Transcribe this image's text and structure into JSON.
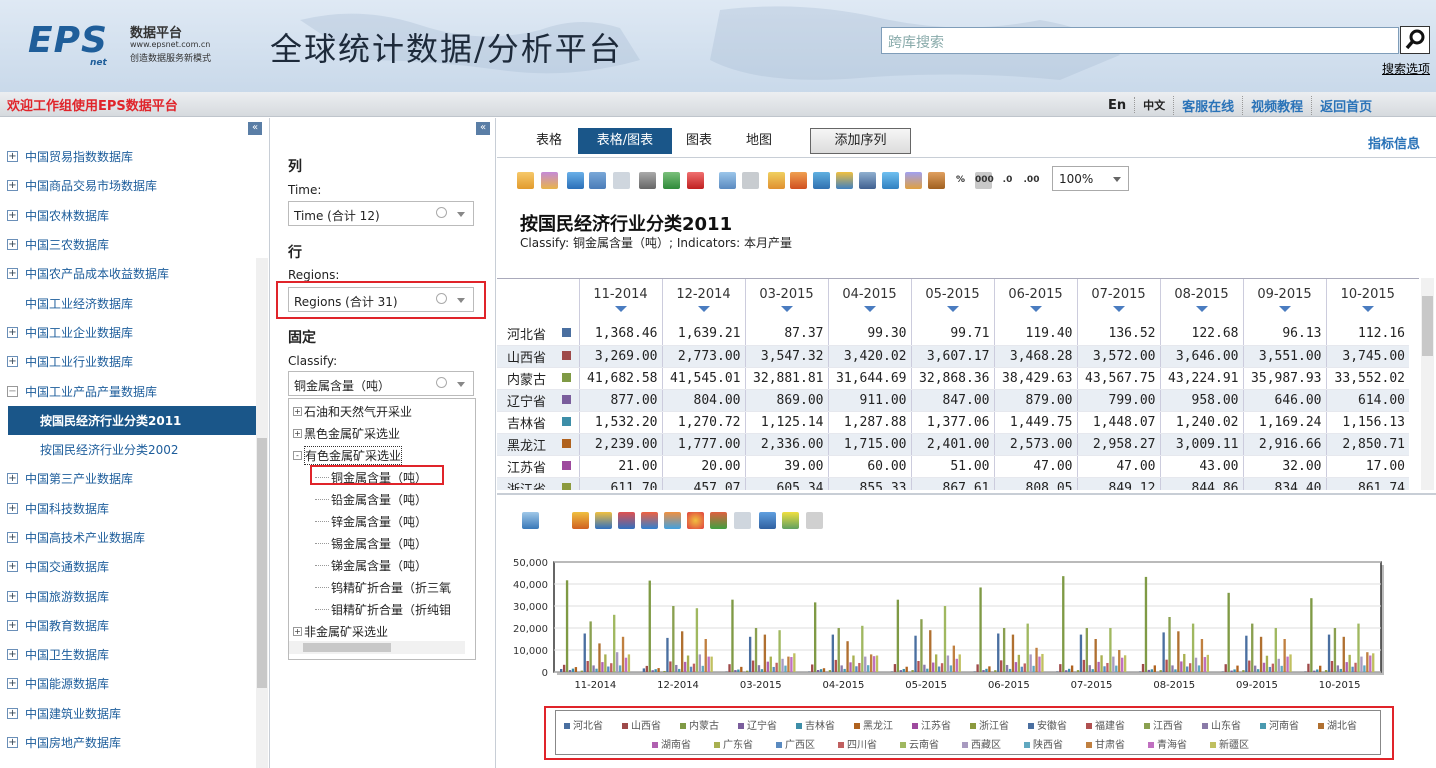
{
  "header": {
    "logo": {
      "brand": "EPS",
      "net": "net",
      "cn": "数据平台",
      "url": "www.epsnet.com.cn",
      "slogan": "创造数据服务新模式"
    },
    "title": "全球统计数据/分析平台",
    "search_placeholder": "跨库搜索",
    "search_options": "搜索选项"
  },
  "topbar": {
    "welcome": "欢迎工作组使用EPS数据平台",
    "links": [
      "En",
      "中文",
      "客服在线",
      "视频教程",
      "返回首页"
    ]
  },
  "sidebar": {
    "collapse": "«",
    "items": [
      {
        "label": "中国贸易指数数据库",
        "type": "db"
      },
      {
        "label": "中国商品交易市场数据库",
        "type": "db"
      },
      {
        "label": "中国农林数据库",
        "type": "db"
      },
      {
        "label": "中国三农数据库",
        "type": "db"
      },
      {
        "label": "中国农产品成本收益数据库",
        "type": "db"
      },
      {
        "label": "中国工业经济数据库",
        "type": "sub2"
      },
      {
        "label": "中国工业企业数据库",
        "type": "db"
      },
      {
        "label": "中国工业行业数据库",
        "type": "db"
      },
      {
        "label": "中国工业产品产量数据库",
        "type": "open"
      },
      {
        "label": "按国民经济行业分类2011",
        "type": "selected"
      },
      {
        "label": "按国民经济行业分类2002",
        "type": "sub"
      },
      {
        "label": "中国第三产业数据库",
        "type": "db"
      },
      {
        "label": "中国科技数据库",
        "type": "db"
      },
      {
        "label": "中国高技术产业数据库",
        "type": "db"
      },
      {
        "label": "中国交通数据库",
        "type": "db"
      },
      {
        "label": "中国旅游数据库",
        "type": "db"
      },
      {
        "label": "中国教育数据库",
        "type": "db"
      },
      {
        "label": "中国卫生数据库",
        "type": "db"
      },
      {
        "label": "中国能源数据库",
        "type": "db"
      },
      {
        "label": "中国建筑业数据库",
        "type": "db"
      },
      {
        "label": "中国房地产数据库",
        "type": "db"
      }
    ]
  },
  "dims": {
    "col_heading": "列",
    "time_label": "Time:",
    "time_value": "Time (合计 12)",
    "row_heading": "行",
    "regions_label": "Regions:",
    "regions_value": "Regions (合计 31)",
    "fixed_heading": "固定",
    "classify_label": "Classify:",
    "classify_value": "铜金属含量（吨）",
    "tree": [
      {
        "label": "石油和天然气开采业",
        "box": "+",
        "level": 0
      },
      {
        "label": "黑色金属矿采选业",
        "box": "+",
        "level": 0
      },
      {
        "label": "有色金属矿采选业",
        "box": "-",
        "level": 0
      },
      {
        "label": "铜金属含量（吨）",
        "box": "",
        "level": 1
      },
      {
        "label": "铅金属含量（吨）",
        "box": "",
        "level": 1
      },
      {
        "label": "锌金属含量（吨）",
        "box": "",
        "level": 1
      },
      {
        "label": "锡金属含量（吨）",
        "box": "",
        "level": 1
      },
      {
        "label": "锑金属含量（吨）",
        "box": "",
        "level": 1
      },
      {
        "label": "钨精矿折合量（折三氧",
        "box": "",
        "level": 1
      },
      {
        "label": "钼精矿折合量（折纯钼",
        "box": "",
        "level": 1
      },
      {
        "label": "非金属矿采选业",
        "box": "+",
        "level": 0
      }
    ]
  },
  "main": {
    "tabs": [
      "表格",
      "表格/图表",
      "图表",
      "地图"
    ],
    "active_tab": 1,
    "add_series": "添加序列",
    "indicator_info": "指标信息",
    "zoom": "100%",
    "percent_icon": "%",
    "thousands_icon": "000",
    "dec_icons": [
      ".0",
      ".00"
    ],
    "table_title": "按国民经济行业分类2011",
    "table_subtitle": "Classify: 铜金属含量（吨）; Indicators: 本月产量"
  },
  "table": {
    "columns": [
      "11-2014",
      "12-2014",
      "03-2015",
      "04-2015",
      "05-2015",
      "06-2015",
      "07-2015",
      "08-2015",
      "09-2015",
      "10-2015"
    ],
    "rows": [
      {
        "name": "河北省",
        "color": "#4a6fa0",
        "values": [
          "1,368.46",
          "1,639.21",
          "87.37",
          "99.30",
          "99.71",
          "119.40",
          "136.52",
          "122.68",
          "96.13",
          "112.16"
        ]
      },
      {
        "name": "山西省",
        "color": "#9e4a4a",
        "values": [
          "3,269.00",
          "2,773.00",
          "3,547.32",
          "3,420.02",
          "3,607.17",
          "3,468.28",
          "3,572.00",
          "3,646.00",
          "3,551.00",
          "3,745.00"
        ]
      },
      {
        "name": "内蒙古",
        "color": "#7f9a45",
        "values": [
          "41,682.58",
          "41,545.01",
          "32,881.81",
          "31,644.69",
          "32,868.36",
          "38,429.63",
          "43,567.75",
          "43,224.91",
          "35,987.93",
          "33,552.02"
        ]
      },
      {
        "name": "辽宁省",
        "color": "#7a5d9c",
        "values": [
          "877.00",
          "804.00",
          "869.00",
          "911.00",
          "847.00",
          "879.00",
          "799.00",
          "958.00",
          "646.00",
          "614.00"
        ]
      },
      {
        "name": "吉林省",
        "color": "#3d8ea8",
        "values": [
          "1,532.20",
          "1,270.72",
          "1,125.14",
          "1,287.88",
          "1,377.06",
          "1,449.75",
          "1,448.07",
          "1,240.02",
          "1,169.24",
          "1,156.13"
        ]
      },
      {
        "name": "黑龙江",
        "color": "#b0621e",
        "values": [
          "2,239.00",
          "1,777.00",
          "2,336.00",
          "1,715.00",
          "2,401.00",
          "2,573.00",
          "2,958.27",
          "3,009.11",
          "2,916.66",
          "2,850.71"
        ]
      },
      {
        "name": "江苏省",
        "color": "#9e4a9e",
        "values": [
          "21.00",
          "20.00",
          "39.00",
          "60.00",
          "51.00",
          "47.00",
          "47.00",
          "43.00",
          "32.00",
          "17.00"
        ]
      },
      {
        "name": "浙江省",
        "color": "#8c9a3e",
        "values": [
          "611.70",
          "457.07",
          "605.34",
          "855.33",
          "867.61",
          "808.05",
          "849.12",
          "844.86",
          "834.40",
          "861.74"
        ]
      }
    ]
  },
  "chart_data": {
    "type": "bar",
    "categories": [
      "11-2014",
      "12-2014",
      "03-2015",
      "04-2015",
      "05-2015",
      "06-2015",
      "07-2015",
      "08-2015",
      "09-2015",
      "10-2015"
    ],
    "ylim": [
      0,
      50000
    ],
    "yticks": [
      "0",
      "10,000",
      "20,000",
      "30,000",
      "40,000",
      "50,000"
    ],
    "grid": true,
    "legend_position": "bottom",
    "series": [
      {
        "name": "河北省",
        "color": "#4a6fa0",
        "values": [
          1368.46,
          1639.21,
          87.37,
          99.3,
          99.71,
          119.4,
          136.52,
          122.68,
          96.13,
          112.16
        ]
      },
      {
        "name": "山西省",
        "color": "#9e4a4a",
        "values": [
          3269,
          2773,
          3547.32,
          3420.02,
          3607.17,
          3468.28,
          3572,
          3646,
          3551,
          3745
        ]
      },
      {
        "name": "内蒙古",
        "color": "#7f9a45",
        "values": [
          41682.58,
          41545.01,
          32881.81,
          31644.69,
          32868.36,
          38429.63,
          43567.75,
          43224.91,
          35987.93,
          33552.02
        ]
      },
      {
        "name": "辽宁省",
        "color": "#7a5d9c",
        "values": [
          877,
          804,
          869,
          911,
          847,
          879,
          799,
          958,
          646,
          614
        ]
      },
      {
        "name": "吉林省",
        "color": "#3d8ea8",
        "values": [
          1532.2,
          1270.72,
          1125.14,
          1287.88,
          1377.06,
          1449.75,
          1448.07,
          1240.02,
          1169.24,
          1156.13
        ]
      },
      {
        "name": "黑龙江",
        "color": "#b0621e",
        "values": [
          2239,
          1777,
          2336,
          1715,
          2401,
          2573,
          2958.27,
          3009.11,
          2916.66,
          2850.71
        ]
      },
      {
        "name": "江苏省",
        "color": "#9e4a9e",
        "values": [
          21,
          20,
          39,
          60,
          51,
          47,
          47,
          43,
          32,
          17
        ]
      },
      {
        "name": "浙江省",
        "color": "#8c9a3e",
        "values": [
          611.7,
          457.07,
          605.34,
          855.33,
          867.61,
          808.05,
          849.12,
          844.86,
          834.4,
          861.74
        ]
      },
      {
        "name": "安徽省",
        "color": "#4a6fa0",
        "values": [
          17500,
          15500,
          16000,
          17000,
          16500,
          17500,
          17000,
          18000,
          16500,
          17000
        ]
      },
      {
        "name": "福建省",
        "color": "#b05050",
        "values": [
          5000,
          4800,
          5200,
          5500,
          5000,
          5300,
          5500,
          5600,
          5200,
          5000
        ]
      },
      {
        "name": "江西省",
        "color": "#8aa050",
        "values": [
          23000,
          30000,
          20000,
          20000,
          24000,
          20000,
          20000,
          25000,
          22000,
          20000
        ]
      },
      {
        "name": "山东省",
        "color": "#8a7aa8",
        "values": [
          3000,
          3200,
          3100,
          3000,
          3300,
          3200,
          3100,
          3000,
          2900,
          3000
        ]
      },
      {
        "name": "河南省",
        "color": "#4a9ab0",
        "values": [
          1500,
          1400,
          1300,
          1400,
          1500,
          1400,
          1300,
          1200,
          1300,
          1400
        ]
      },
      {
        "name": "湖北省",
        "color": "#b07030",
        "values": [
          13000,
          18500,
          17000,
          14000,
          19000,
          17000,
          15000,
          18500,
          16000,
          16000
        ]
      },
      {
        "name": "湖南省",
        "color": "#b060b0",
        "values": [
          4500,
          4600,
          4700,
          4400,
          4300,
          4500,
          4600,
          4800,
          4200,
          4500
        ]
      },
      {
        "name": "广东省",
        "color": "#a8b050",
        "values": [
          8000,
          7500,
          7000,
          7500,
          8000,
          7800,
          7600,
          8200,
          7400,
          7800
        ]
      },
      {
        "name": "广西区",
        "color": "#5a8ac0",
        "values": [
          2500,
          2400,
          2300,
          2600,
          2500,
          2400,
          2600,
          2500,
          2300,
          2400
        ]
      },
      {
        "name": "四川省",
        "color": "#c06060",
        "values": [
          4000,
          3800,
          4200,
          4100,
          4000,
          3900,
          4100,
          4000,
          3800,
          4200
        ]
      },
      {
        "name": "云南省",
        "color": "#a0b860",
        "values": [
          26000,
          29000,
          19000,
          21000,
          30000,
          22000,
          20000,
          22000,
          20000,
          22000
        ]
      },
      {
        "name": "西藏区",
        "color": "#a89ac0",
        "values": [
          9000,
          8000,
          6000,
          7000,
          7500,
          8000,
          7000,
          6500,
          6000,
          7000
        ]
      },
      {
        "name": "陕西省",
        "color": "#60a8c0",
        "values": [
          3000,
          2800,
          2900,
          3100,
          3000,
          2800,
          2900,
          3000,
          2800,
          3000
        ]
      },
      {
        "name": "甘肃省",
        "color": "#c08040",
        "values": [
          16000,
          15000,
          7000,
          8000,
          12000,
          11000,
          10000,
          15000,
          15000,
          9000
        ]
      },
      {
        "name": "青海省",
        "color": "#c070c0",
        "values": [
          6500,
          7000,
          6800,
          7200,
          6000,
          7000,
          6500,
          6800,
          7000,
          7500
        ]
      },
      {
        "name": "新疆区",
        "color": "#c0c060",
        "values": [
          8000,
          7000,
          8500,
          7500,
          8000,
          8200,
          7600,
          7800,
          8000,
          8500
        ]
      }
    ]
  }
}
